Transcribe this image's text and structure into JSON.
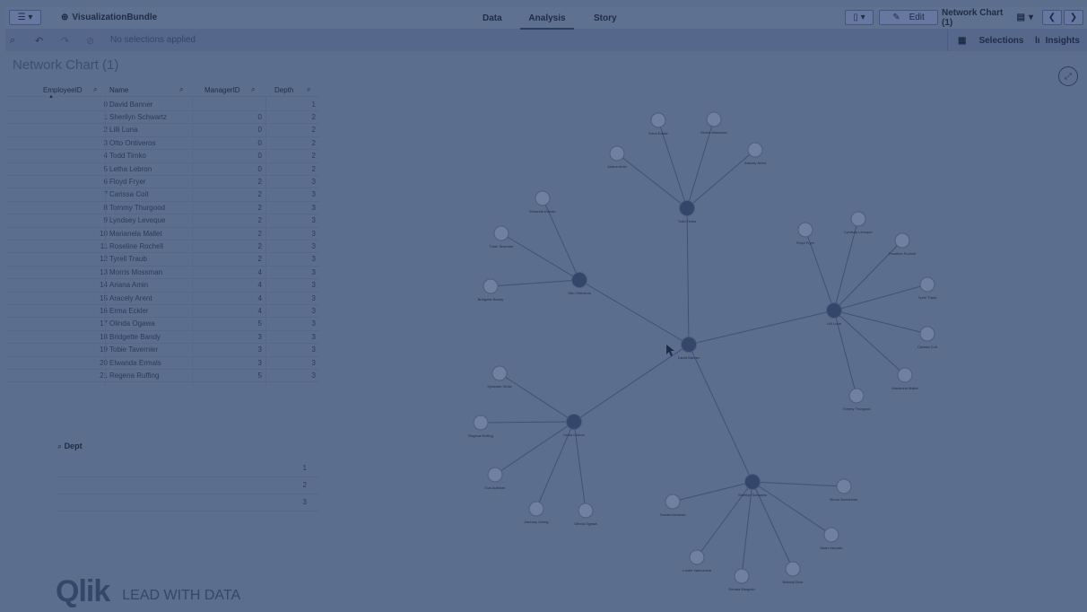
{
  "topbar": {
    "app_name": "VisualizationBundle",
    "tabs": [
      "Data",
      "Analysis",
      "Story"
    ],
    "active_tab": "Analysis",
    "edit_label": "Edit",
    "sheet_selector": "Network Chart (1)"
  },
  "selection_bar": {
    "no_selections": "No selections applied",
    "selections_label": "Selections",
    "insights_label": "Insights"
  },
  "sheet": {
    "title": "Network Chart (1)"
  },
  "table": {
    "columns": [
      "EmployeeID",
      "Name",
      "ManagerID",
      "Depth"
    ],
    "rows": [
      [
        "0",
        "David Banner",
        "",
        "1"
      ],
      [
        "1",
        "Sherilyn Schwartz",
        "0",
        "2"
      ],
      [
        "2",
        "Lilli Luna",
        "0",
        "2"
      ],
      [
        "3",
        "Otto Ontiveros",
        "0",
        "2"
      ],
      [
        "4",
        "Todd Timko",
        "0",
        "2"
      ],
      [
        "5",
        "Letha Lebron",
        "0",
        "2"
      ],
      [
        "6",
        "Floyd Fryer",
        "2",
        "3"
      ],
      [
        "7",
        "Carissa Coit",
        "2",
        "3"
      ],
      [
        "8",
        "Tommy Thurgood",
        "2",
        "3"
      ],
      [
        "9",
        "Lyndsey Leveque",
        "2",
        "3"
      ],
      [
        "10",
        "Marianela Mallet",
        "2",
        "3"
      ],
      [
        "11",
        "Roseline Rochell",
        "2",
        "3"
      ],
      [
        "12",
        "Tyrell Traub",
        "2",
        "3"
      ],
      [
        "13",
        "Morris Mossman",
        "4",
        "3"
      ],
      [
        "14",
        "Ariana Amin",
        "4",
        "3"
      ],
      [
        "15",
        "Aracely Arent",
        "4",
        "3"
      ],
      [
        "16",
        "Erma Eckler",
        "4",
        "3"
      ],
      [
        "17",
        "Olinda Ogawa",
        "5",
        "3"
      ],
      [
        "18",
        "Bridgette Bandy",
        "3",
        "3"
      ],
      [
        "19",
        "Tobie Tavernier",
        "3",
        "3"
      ],
      [
        "20",
        "Elwanda Ermals",
        "3",
        "3"
      ],
      [
        "21",
        "Regena Ruffing",
        "5",
        "3"
      ]
    ]
  },
  "dept": {
    "title": "Dept",
    "values": [
      "1",
      "2",
      "3"
    ]
  },
  "network": {
    "nodes": [
      {
        "id": "root",
        "label": "David Banner"
      },
      {
        "id": "todd",
        "label": "Todd Timko"
      },
      {
        "id": "erma",
        "label": "Erma Eckler"
      },
      {
        "id": "morris",
        "label": "Morris Mossman"
      },
      {
        "id": "ariana",
        "label": "Ariana Amin"
      },
      {
        "id": "aracely",
        "label": "Aracely Arent"
      },
      {
        "id": "otto",
        "label": "Otto Ontiveros"
      },
      {
        "id": "elwanda",
        "label": "Elwanda Ermals"
      },
      {
        "id": "tobie",
        "label": "Tobie Tavernier"
      },
      {
        "id": "bridgette",
        "label": "Bridgette Bandy"
      },
      {
        "id": "lilli",
        "label": "Lilli Luna"
      },
      {
        "id": "floyd",
        "label": "Floyd Fryer"
      },
      {
        "id": "lyndsey",
        "label": "Lyndsey Leveque"
      },
      {
        "id": "roseline",
        "label": "Roseline Rochell"
      },
      {
        "id": "tyrell",
        "label": "Tyrell Traub"
      },
      {
        "id": "carissa",
        "label": "Carissa Coit"
      },
      {
        "id": "marianela",
        "label": "Marianela Mallet"
      },
      {
        "id": "tommy",
        "label": "Tommy Thurgood"
      },
      {
        "id": "letha",
        "label": "Letha Lebron"
      },
      {
        "id": "sylvester",
        "label": "Sylvester Stoltz"
      },
      {
        "id": "regena",
        "label": "Regena Ruffing"
      },
      {
        "id": "gus",
        "label": "Gus Aultman"
      },
      {
        "id": "zachary",
        "label": "Zachary Zaring"
      },
      {
        "id": "olinda",
        "label": "Olinda Ogawa"
      },
      {
        "id": "sherilyn",
        "label": "Sherilyn Schwartz"
      },
      {
        "id": "tamala",
        "label": "Tamala Mcdavid"
      },
      {
        "id": "bruno",
        "label": "Bruno Bonheimer"
      },
      {
        "id": "nash",
        "label": "Nash Harvatin"
      },
      {
        "id": "lourie",
        "label": "Lourie Valenzuela"
      },
      {
        "id": "renata",
        "label": "Renata Margolin"
      },
      {
        "id": "brittany",
        "label": "Brittany Buhr"
      }
    ],
    "edges": [
      [
        "root",
        "todd"
      ],
      [
        "todd",
        "erma"
      ],
      [
        "todd",
        "morris"
      ],
      [
        "todd",
        "ariana"
      ],
      [
        "todd",
        "aracely"
      ],
      [
        "root",
        "otto"
      ],
      [
        "otto",
        "elwanda"
      ],
      [
        "otto",
        "tobie"
      ],
      [
        "otto",
        "bridgette"
      ],
      [
        "root",
        "lilli"
      ],
      [
        "lilli",
        "floyd"
      ],
      [
        "lilli",
        "lyndsey"
      ],
      [
        "lilli",
        "roseline"
      ],
      [
        "lilli",
        "tyrell"
      ],
      [
        "lilli",
        "carissa"
      ],
      [
        "lilli",
        "marianela"
      ],
      [
        "lilli",
        "tommy"
      ],
      [
        "root",
        "letha"
      ],
      [
        "letha",
        "sylvester"
      ],
      [
        "letha",
        "regena"
      ],
      [
        "letha",
        "gus"
      ],
      [
        "letha",
        "zachary"
      ],
      [
        "letha",
        "olinda"
      ],
      [
        "root",
        "sherilyn"
      ],
      [
        "sherilyn",
        "tamala"
      ],
      [
        "sherilyn",
        "bruno"
      ],
      [
        "sherilyn",
        "nash"
      ],
      [
        "sherilyn",
        "lourie"
      ],
      [
        "sherilyn",
        "renata"
      ],
      [
        "sherilyn",
        "brittany"
      ]
    ]
  },
  "logo": {
    "word": "Qlik",
    "tagline": "LEAD WITH DATA"
  }
}
